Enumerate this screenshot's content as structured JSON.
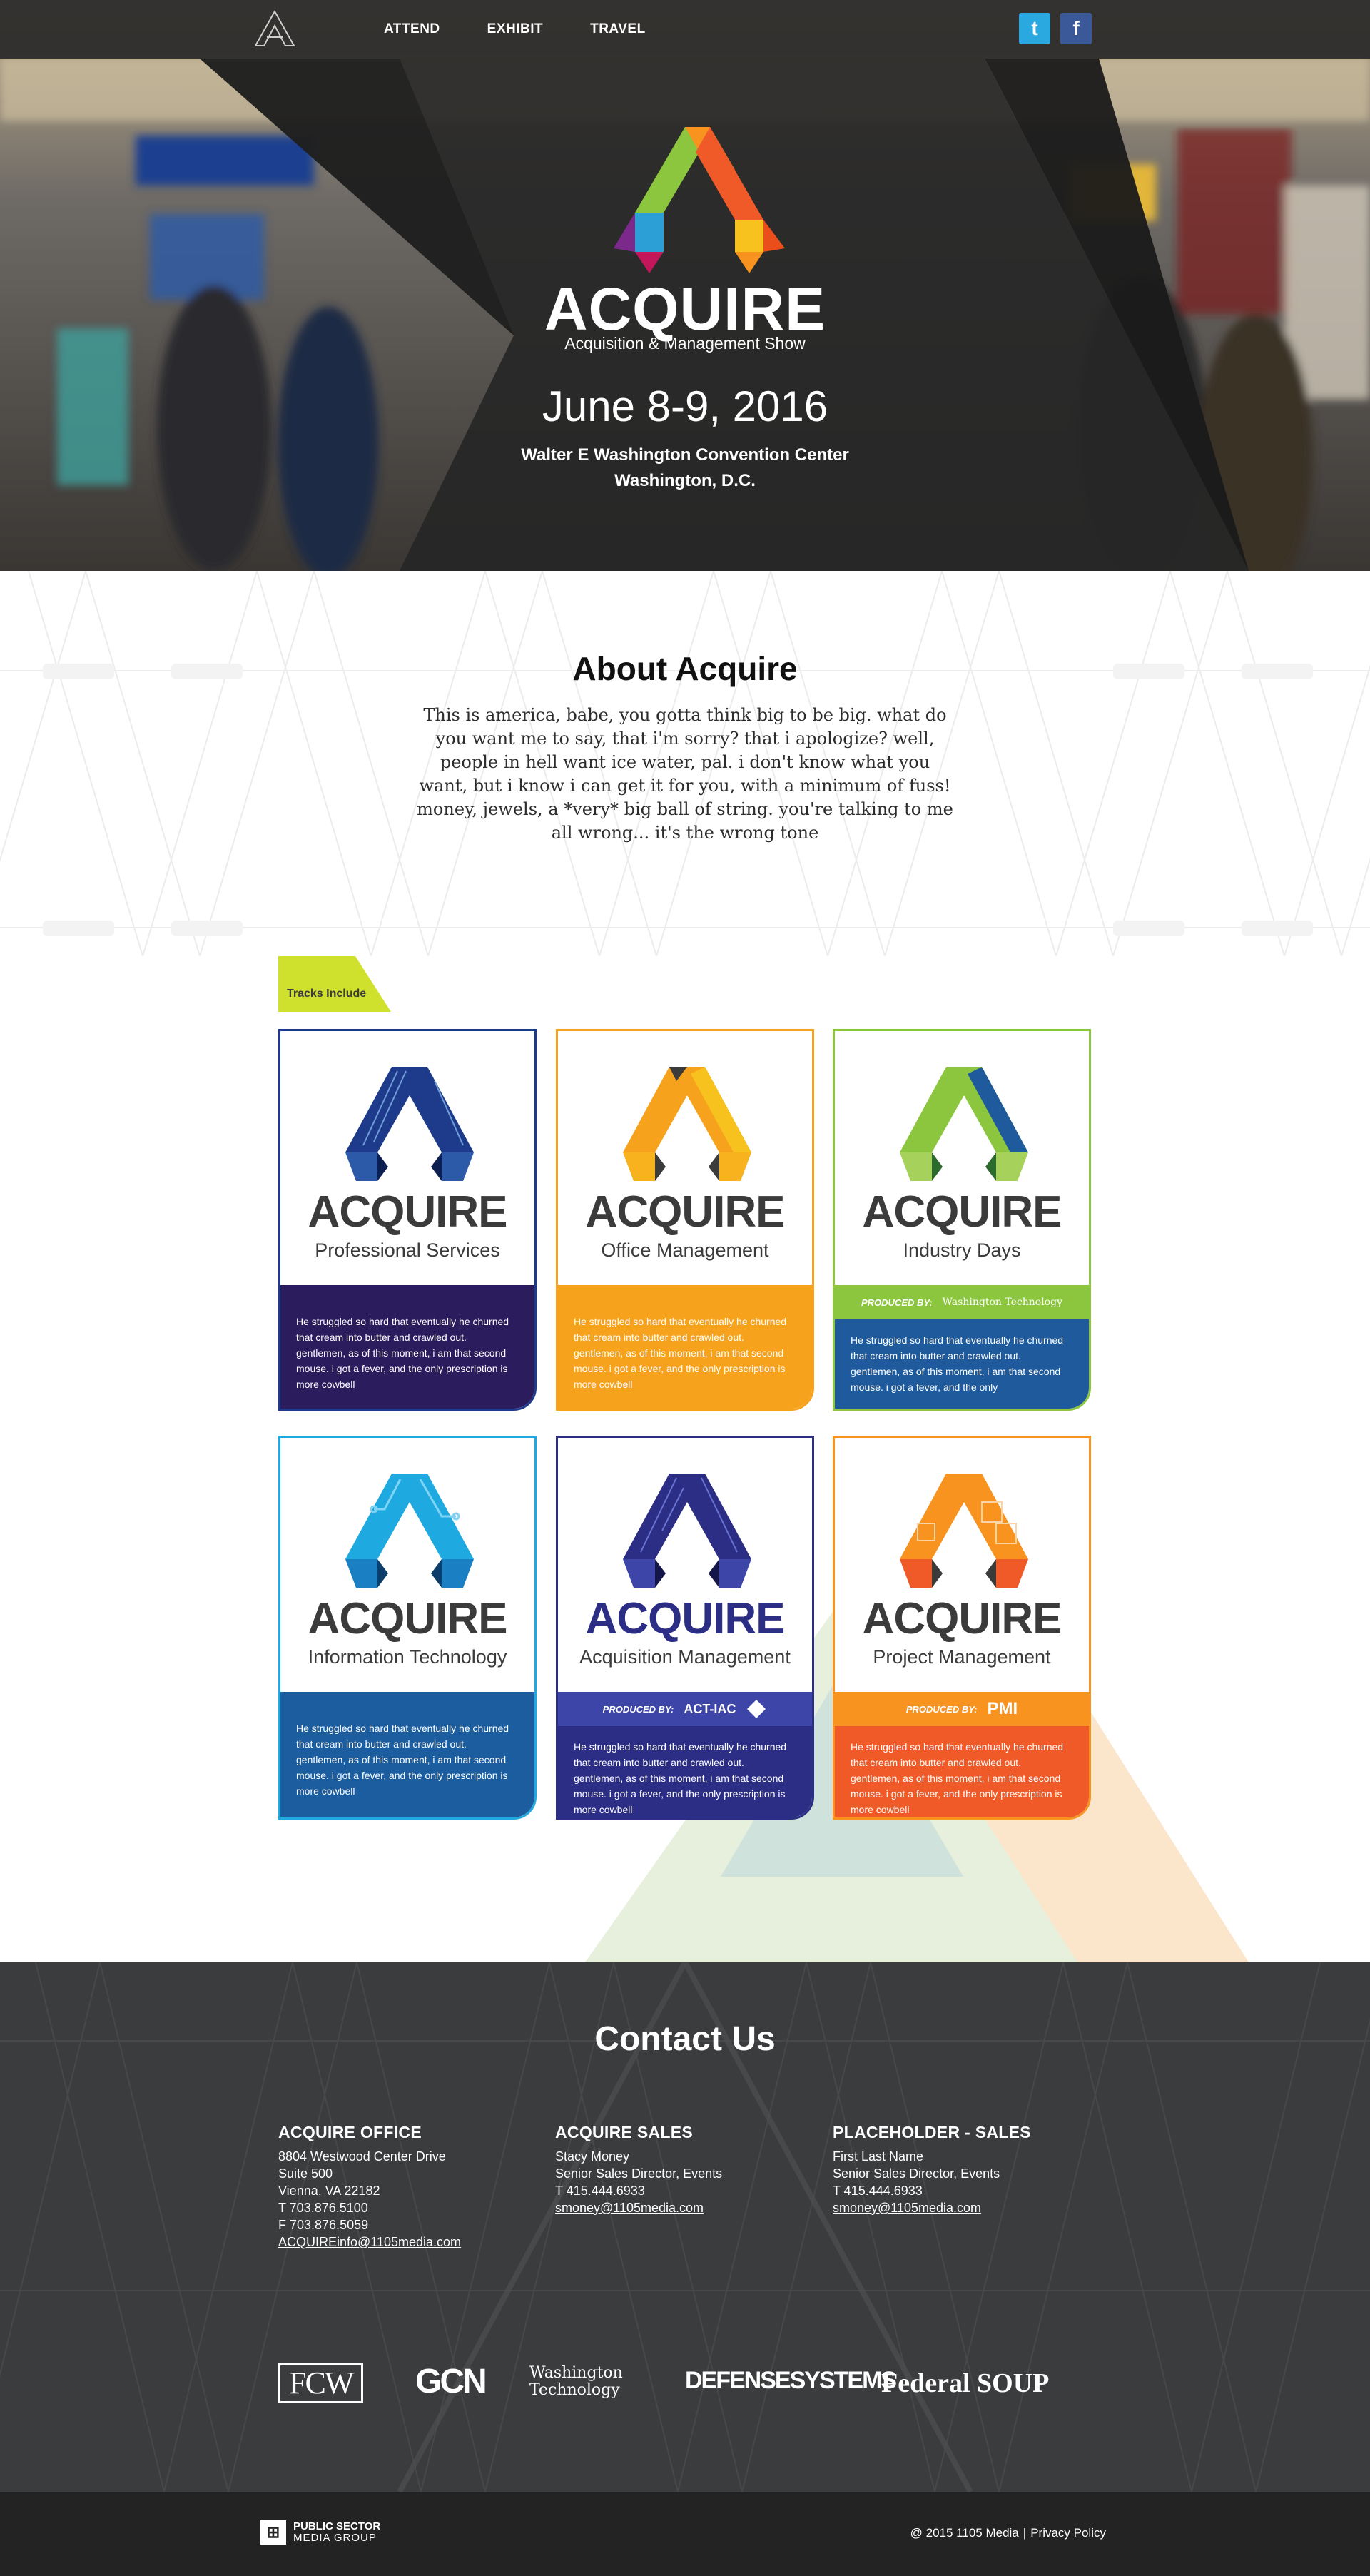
{
  "nav": {
    "links": [
      "ATTEND",
      "EXHIBIT",
      "TRAVEL"
    ],
    "social": {
      "twitter_glyph": "t",
      "facebook_glyph": "f"
    }
  },
  "hero": {
    "brand": "ACQUIRE",
    "tagline": "Acquisition & Management Show",
    "date": "June 8-9, 2016",
    "venue_line1": "Walter E Washington Convention Center",
    "venue_line2": "Washington, D.C."
  },
  "about": {
    "title": "About Acquire",
    "body": "This is america, babe, you gotta think big to be big. what do you want me to say, that i'm sorry? that i apologize? well, people in hell want ice water, pal. i don't know what you want, but i know i can get it for you, with a minimum of fuss! money, jewels, a *very* big ball of string. you're talking to me all wrong... it's the wrong tone"
  },
  "tracks": {
    "tab_label": "Tracks Include",
    "produced_by_label": "PRODUCED BY:",
    "cards": [
      {
        "brand": "ACQUIRE",
        "name": "Professional Services",
        "produced_by": "",
        "text": "He struggled so hard that eventually he churned that cream into butter and crawled out. gentlemen, as of this moment, i am that second mouse. i got a fever, and the only prescription is more cowbell"
      },
      {
        "brand": "ACQUIRE",
        "name": "Office Management",
        "produced_by": "",
        "text": "He struggled so hard that eventually he churned that cream into butter and crawled out. gentlemen, as of this moment, i am that second mouse. i got a fever, and the only prescription is more cowbell"
      },
      {
        "brand": "ACQUIRE",
        "name": "Industry Days",
        "produced_by": "Washington Technology",
        "text": "He struggled so hard that eventually he churned that cream into butter and crawled out. gentlemen, as of this moment, i am that second mouse. i got a fever, and the only"
      },
      {
        "brand": "ACQUIRE",
        "name": "Information Technology",
        "produced_by": "",
        "text": "He struggled so hard that eventually he churned that cream into butter and crawled out. gentlemen, as of this moment, i am that second mouse. i got a fever, and the only prescription is more cowbell"
      },
      {
        "brand": "ACQUIRE",
        "name": "Acquisition Management",
        "produced_by": "ACT-IAC",
        "text": "He struggled so hard that eventually he churned that cream into butter and crawled out. gentlemen, as of this moment, i am that second mouse. i got a fever, and the only prescription is more cowbell"
      },
      {
        "brand": "ACQUIRE",
        "name": "Project Management",
        "produced_by": "PMI",
        "text": "He struggled so hard that eventually he churned that cream into butter and crawled out. gentlemen, as of this moment, i am that second mouse. i got a fever, and the only prescription is more cowbell"
      }
    ]
  },
  "contact": {
    "title": "Contact Us",
    "office": {
      "heading": "ACQUIRE OFFICE",
      "lines": [
        "8804 Westwood Center Drive",
        "Suite 500",
        "Vienna, VA 22182",
        "T 703.876.5100",
        "F 703.876.5059"
      ],
      "email": "ACQUIREinfo@1105media.com"
    },
    "sales": {
      "heading": "ACQUIRE SALES",
      "lines": [
        "Stacy Money",
        "Senior Sales Director, Events",
        "T 415.444.6933"
      ],
      "email": "smoney@1105media.com"
    },
    "placeholder": {
      "heading": "PLACEHOLDER  - SALES",
      "lines": [
        "First Last Name",
        "Senior Sales Director, Events",
        "T 415.444.6933"
      ],
      "email": "smoney@1105media.com"
    },
    "publications": [
      "FCW",
      "GCN",
      "Washington Technology",
      "DEFENSESYSTEMS",
      "Federal SOUP"
    ]
  },
  "footer": {
    "logo_line1": "PUBLIC SECTOR",
    "logo_line2": "MEDIA GROUP",
    "copyright": "@ 2015 1105 Media",
    "separator": "|",
    "privacy": "Privacy Policy"
  },
  "colors": {
    "nav_bg": "#282828",
    "tab_lime": "#cfe12d",
    "professional": "#1d3b8a",
    "office": "#f6a21c",
    "industry": "#8cc63f",
    "industry_band": "#1f5b9c",
    "information": "#1eaae1",
    "information_band": "#1b5d9e",
    "acquisition": "#2b2e84",
    "acquisition_band": "#3d45a9",
    "project": "#f7931e",
    "project_band": "#f05a28",
    "contact_bg": "#3b3c3e",
    "footer_bg": "#232323"
  }
}
